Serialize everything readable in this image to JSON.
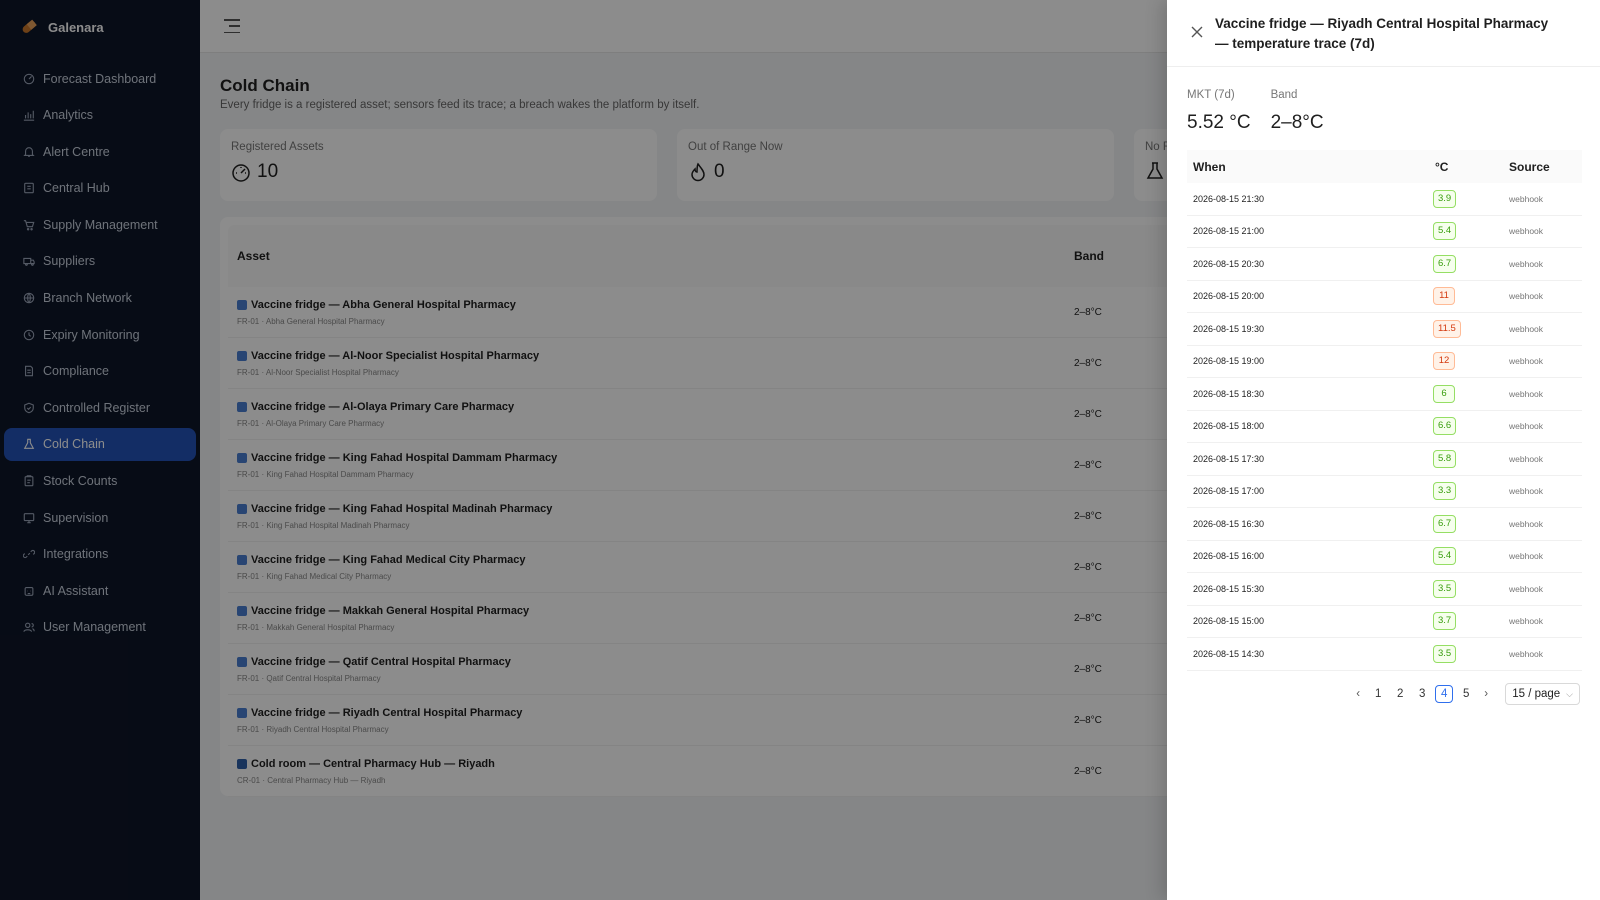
{
  "app": {
    "name": "Galenara"
  },
  "sidebar": {
    "items": [
      {
        "label": "Forecast Dashboard",
        "icon": "dashboard-icon"
      },
      {
        "label": "Analytics",
        "icon": "chart-icon"
      },
      {
        "label": "Alert Centre",
        "icon": "bell-icon"
      },
      {
        "label": "Central Hub",
        "icon": "building-icon"
      },
      {
        "label": "Supply Management",
        "icon": "cart-icon"
      },
      {
        "label": "Suppliers",
        "icon": "truck-icon"
      },
      {
        "label": "Branch Network",
        "icon": "globe-icon"
      },
      {
        "label": "Expiry Monitoring",
        "icon": "clock-icon"
      },
      {
        "label": "Compliance",
        "icon": "document-icon"
      },
      {
        "label": "Controlled Register",
        "icon": "shield-icon"
      },
      {
        "label": "Cold Chain",
        "icon": "flask-icon"
      },
      {
        "label": "Stock Counts",
        "icon": "clipboard-icon"
      },
      {
        "label": "Supervision",
        "icon": "monitor-icon"
      },
      {
        "label": "Integrations",
        "icon": "link-icon"
      },
      {
        "label": "AI Assistant",
        "icon": "robot-icon"
      },
      {
        "label": "User Management",
        "icon": "users-icon"
      }
    ],
    "active_label": "Cold Chain"
  },
  "page": {
    "title": "Cold Chain",
    "subtitle": "Every fridge is a registered asset; sensors feed its trace; a breach wakes the platform by itself."
  },
  "stats": [
    {
      "label": "Registered Assets",
      "value": "10",
      "icon": "dashboard-icon"
    },
    {
      "label": "Out of Range Now",
      "value": "0",
      "icon": "fire-icon"
    },
    {
      "label": "No R",
      "value": "",
      "icon": "flask-icon"
    }
  ],
  "assets_table": {
    "columns": {
      "asset": "Asset",
      "band": "Band"
    },
    "rows": [
      {
        "name": "Vaccine fridge — Abha General Hospital Pharmacy",
        "sub": "FR-01 · Abha General Hospital Pharmacy",
        "band": "2–8°C"
      },
      {
        "name": "Vaccine fridge — Al-Noor Specialist Hospital Pharmacy",
        "sub": "FR-01 · Al-Noor Specialist Hospital Pharmacy",
        "band": "2–8°C"
      },
      {
        "name": "Vaccine fridge — Al-Olaya Primary Care Pharmacy",
        "sub": "FR-01 · Al-Olaya Primary Care Pharmacy",
        "band": "2–8°C"
      },
      {
        "name": "Vaccine fridge — King Fahad Hospital Dammam Pharmacy",
        "sub": "FR-01 · King Fahad Hospital Dammam Pharmacy",
        "band": "2–8°C"
      },
      {
        "name": "Vaccine fridge — King Fahad Hospital Madinah Pharmacy",
        "sub": "FR-01 · King Fahad Hospital Madinah Pharmacy",
        "band": "2–8°C"
      },
      {
        "name": "Vaccine fridge — King Fahad Medical City Pharmacy",
        "sub": "FR-01 · King Fahad Medical City Pharmacy",
        "band": "2–8°C"
      },
      {
        "name": "Vaccine fridge — Makkah General Hospital Pharmacy",
        "sub": "FR-01 · Makkah General Hospital Pharmacy",
        "band": "2–8°C"
      },
      {
        "name": "Vaccine fridge — Qatif Central Hospital Pharmacy",
        "sub": "FR-01 · Qatif Central Hospital Pharmacy",
        "band": "2–8°C"
      },
      {
        "name": "Vaccine fridge — Riyadh Central Hospital Pharmacy",
        "sub": "FR-01 · Riyadh Central Hospital Pharmacy",
        "band": "2–8°C"
      },
      {
        "name": "Cold room — Central Pharmacy Hub — Riyadh",
        "sub": "CR-01 · Central Pharmacy Hub — Riyadh",
        "band": "2–8°C"
      }
    ]
  },
  "drawer": {
    "title": "Vaccine fridge — Riyadh Central Hospital Pharmacy — temperature trace (7d)",
    "mkt_label": "MKT (7d)",
    "mkt_value": "5.52 °C",
    "band_label": "Band",
    "band_value": "2–8°C",
    "columns": {
      "when": "When",
      "temp": "°C",
      "source": "Source"
    },
    "rows": [
      {
        "when": "2026-08-15 21:30",
        "temp": "3.9",
        "status": "ok",
        "source": "webhook"
      },
      {
        "when": "2026-08-15 21:00",
        "temp": "5.4",
        "status": "ok",
        "source": "webhook"
      },
      {
        "when": "2026-08-15 20:30",
        "temp": "6.7",
        "status": "ok",
        "source": "webhook"
      },
      {
        "when": "2026-08-15 20:00",
        "temp": "11",
        "status": "bad",
        "source": "webhook"
      },
      {
        "when": "2026-08-15 19:30",
        "temp": "11.5",
        "status": "bad",
        "source": "webhook"
      },
      {
        "when": "2026-08-15 19:00",
        "temp": "12",
        "status": "bad",
        "source": "webhook"
      },
      {
        "when": "2026-08-15 18:30",
        "temp": "6",
        "status": "ok",
        "source": "webhook"
      },
      {
        "when": "2026-08-15 18:00",
        "temp": "6.6",
        "status": "ok",
        "source": "webhook"
      },
      {
        "when": "2026-08-15 17:30",
        "temp": "5.8",
        "status": "ok",
        "source": "webhook"
      },
      {
        "when": "2026-08-15 17:00",
        "temp": "3.3",
        "status": "ok",
        "source": "webhook"
      },
      {
        "when": "2026-08-15 16:30",
        "temp": "6.7",
        "status": "ok",
        "source": "webhook"
      },
      {
        "when": "2026-08-15 16:00",
        "temp": "5.4",
        "status": "ok",
        "source": "webhook"
      },
      {
        "when": "2026-08-15 15:30",
        "temp": "3.5",
        "status": "ok",
        "source": "webhook"
      },
      {
        "when": "2026-08-15 15:00",
        "temp": "3.7",
        "status": "ok",
        "source": "webhook"
      },
      {
        "when": "2026-08-15 14:30",
        "temp": "3.5",
        "status": "ok",
        "source": "webhook"
      }
    ],
    "pagination": {
      "pages": [
        "1",
        "2",
        "3",
        "4",
        "5"
      ],
      "current": "4",
      "page_size": "15 / page"
    }
  }
}
